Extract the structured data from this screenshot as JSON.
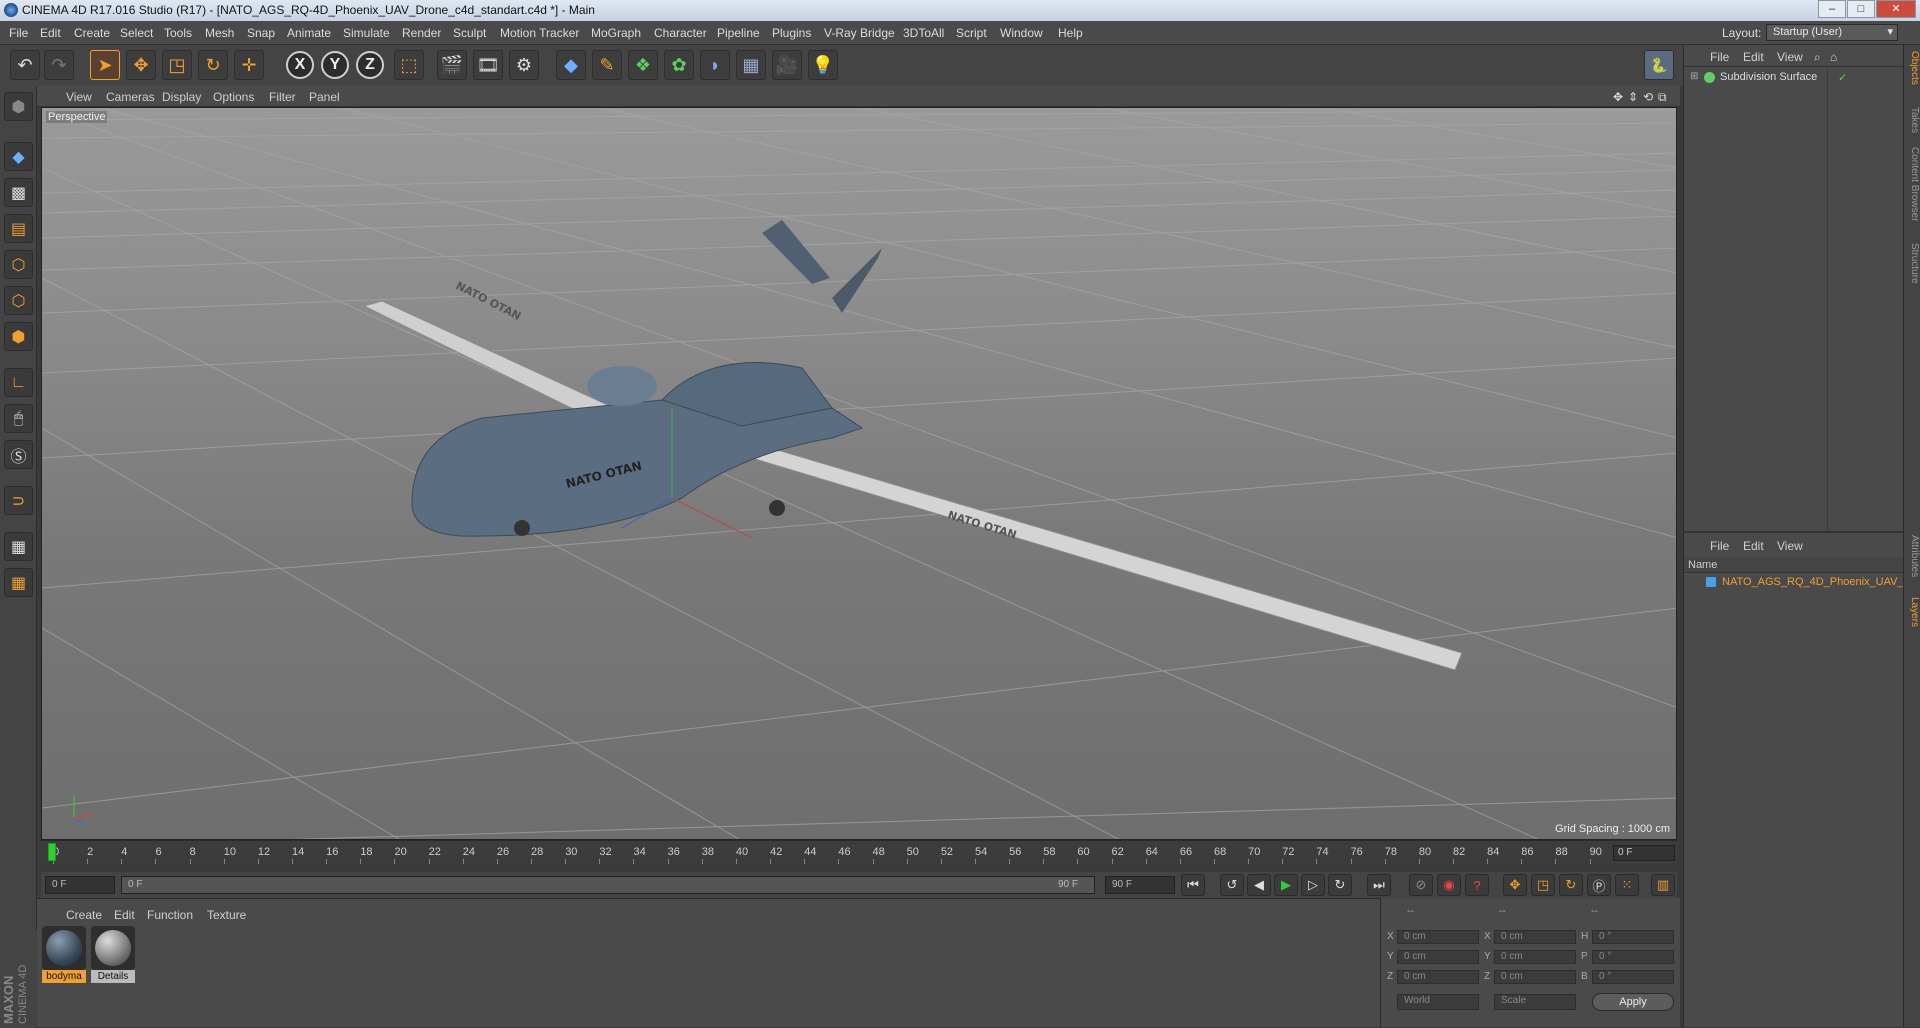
{
  "window": {
    "title": "CINEMA 4D R17.016 Studio (R17) - [NATO_AGS_RQ-4D_Phoenix_UAV_Drone_c4d_standart.c4d *] - Main"
  },
  "menubar": {
    "items": [
      "File",
      "Edit",
      "Create",
      "Select",
      "Tools",
      "Mesh",
      "Snap",
      "Animate",
      "Simulate",
      "Render",
      "Sculpt",
      "Motion Tracker",
      "MoGraph",
      "Character",
      "Pipeline",
      "Plugins",
      "V-Ray Bridge",
      "3DToAll",
      "Script",
      "Window",
      "Help"
    ],
    "layout_label": "Layout:",
    "layout_value": "Startup (User)"
  },
  "toolbar": {
    "axis_x": "X",
    "axis_y": "Y",
    "axis_z": "Z"
  },
  "viewport": {
    "menu": [
      "View",
      "Cameras",
      "Display",
      "Options",
      "Filter",
      "Panel"
    ],
    "label": "Perspective",
    "grid_spacing": "Grid Spacing : 1000 cm",
    "wing_text_left": "NATO OTAN",
    "wing_text_right": "NATO OTAN",
    "fuselage_text": "NATO OTAN"
  },
  "timeline": {
    "ticks": [
      "0",
      "2",
      "4",
      "6",
      "8",
      "10",
      "12",
      "14",
      "16",
      "18",
      "20",
      "22",
      "24",
      "26",
      "28",
      "30",
      "32",
      "34",
      "36",
      "38",
      "40",
      "42",
      "44",
      "46",
      "48",
      "50",
      "52",
      "54",
      "56",
      "58",
      "60",
      "62",
      "64",
      "66",
      "68",
      "70",
      "72",
      "74",
      "76",
      "78",
      "80",
      "82",
      "84",
      "86",
      "88",
      "90"
    ],
    "end_frame": "0 F",
    "current_frame": "0 F",
    "range_start": "0 F",
    "range_end": "90 F",
    "max_frame": "90 F"
  },
  "material_manager": {
    "menu": [
      "Create",
      "Edit",
      "Function",
      "Texture"
    ],
    "materials": [
      {
        "name": "bodyma",
        "selected": true
      },
      {
        "name": "Details",
        "selected": false
      }
    ]
  },
  "coordinates": {
    "header": [
      "--",
      "--",
      "--"
    ],
    "rows": [
      {
        "a": "X",
        "av": "0 cm",
        "b": "X",
        "bv": "0 cm",
        "c": "H",
        "cv": "0 °"
      },
      {
        "a": "Y",
        "av": "0 cm",
        "b": "Y",
        "bv": "0 cm",
        "c": "P",
        "cv": "0 °"
      },
      {
        "a": "Z",
        "av": "0 cm",
        "b": "Z",
        "bv": "0 cm",
        "c": "B",
        "cv": "0 °"
      }
    ],
    "space": "World",
    "mode": "Scale",
    "apply": "Apply"
  },
  "objects_panel": {
    "menu": [
      "File",
      "Edit",
      "View"
    ],
    "items": [
      {
        "name": "Subdivision Surface"
      }
    ]
  },
  "layers_panel": {
    "menu": [
      "File",
      "Edit",
      "View"
    ],
    "column": "Name",
    "items": [
      {
        "name": "NATO_AGS_RQ_4D_Phoenix_UAV_"
      }
    ]
  },
  "side_tabs": [
    "Objects",
    "Takes",
    "Content Browser",
    "Structure",
    "Attributes",
    "Layers"
  ],
  "logo": {
    "brand": "MAXON",
    "product": "CINEMA 4D"
  },
  "colors": {
    "accent_orange": "#f0a030",
    "selection_blue": "#4aa0e8",
    "panel_bg": "#4a4a4a"
  }
}
